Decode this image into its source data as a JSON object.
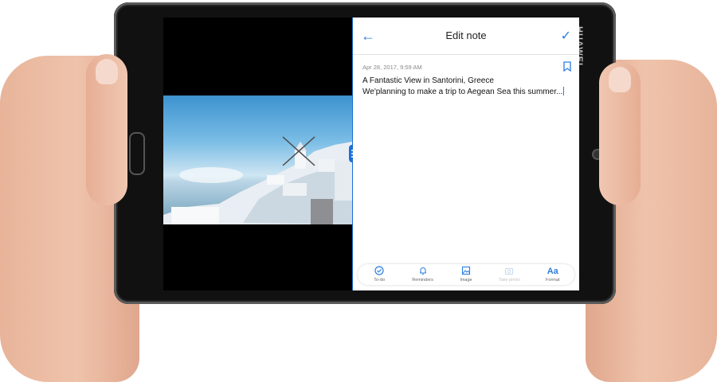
{
  "device": {
    "brand": "HUAWEI"
  },
  "note_editor": {
    "header_title": "Edit note",
    "timestamp": "Apr 28, 2017, 9:59 AM",
    "note_title": "A Fantastic View in Santorini, Greece",
    "note_body": "We'planning to make a trip to Aegean Sea this summer..."
  },
  "toolbar": {
    "items": [
      {
        "label": "To-do",
        "icon": "check-circle-icon",
        "enabled": true
      },
      {
        "label": "Reminders",
        "icon": "bell-icon",
        "enabled": true
      },
      {
        "label": "Image",
        "icon": "image-icon",
        "enabled": true
      },
      {
        "label": "Take photo",
        "icon": "camera-icon",
        "enabled": false
      },
      {
        "label": "Format",
        "icon": "format-icon",
        "glyph": "Aa",
        "enabled": true
      }
    ]
  },
  "colors": {
    "accent": "#2a7de1",
    "split_divider": "#1b6fd8"
  }
}
